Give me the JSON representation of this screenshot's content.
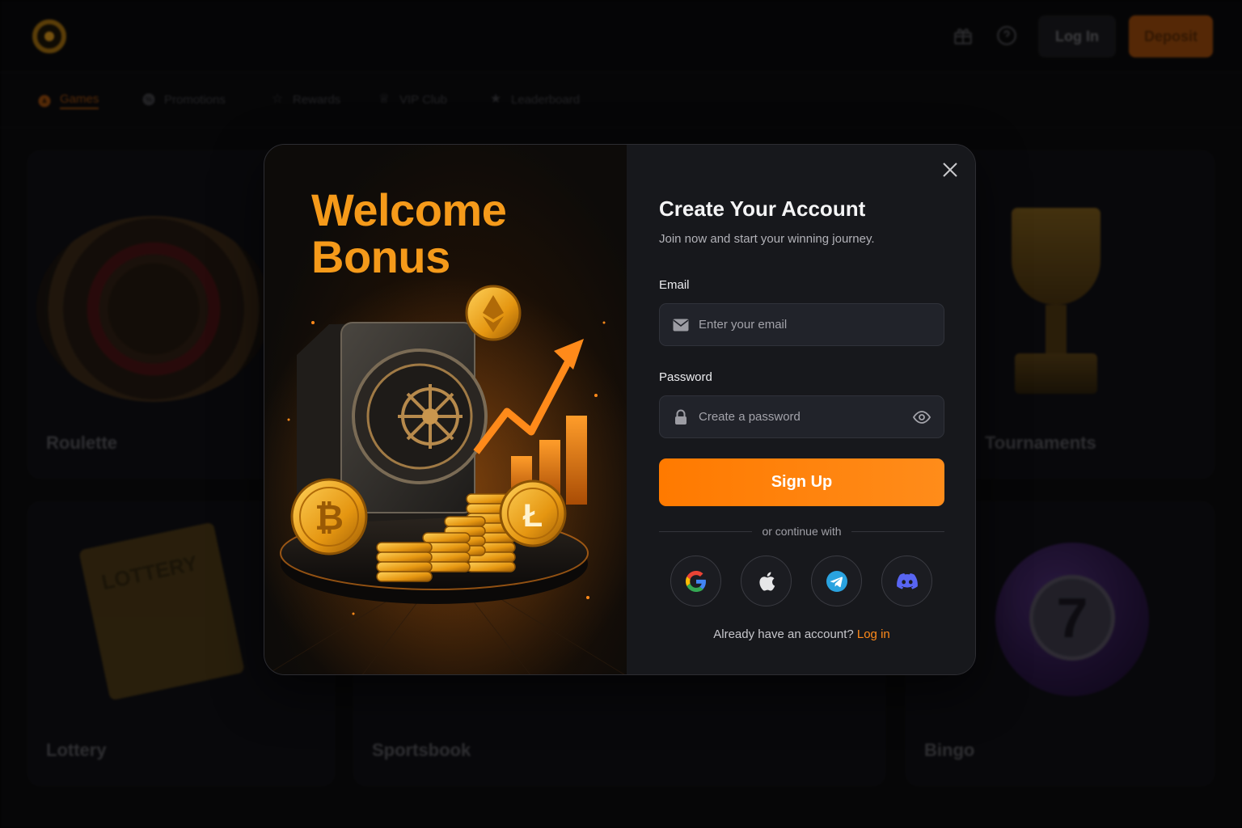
{
  "background": {
    "header": {
      "login_label": "Log In",
      "deposit_label": "Deposit"
    },
    "nav": [
      {
        "label": "Games",
        "icon": "flame-icon",
        "active": true
      },
      {
        "label": "Promotions",
        "icon": "percent-icon",
        "active": false
      },
      {
        "label": "Rewards",
        "icon": "star-icon",
        "active": false
      },
      {
        "label": "VIP Club",
        "icon": "crown-icon",
        "active": false
      },
      {
        "label": "Leaderboard",
        "icon": "star-icon",
        "active": false
      }
    ],
    "cards": [
      {
        "label": "Roulette"
      },
      {
        "label": "Tournaments"
      },
      {
        "label": "Lottery"
      },
      {
        "label": "Sportsbook"
      },
      {
        "label": "Bingo"
      }
    ],
    "ticket_text": "LOTTERY",
    "bingo_number": "7"
  },
  "modal": {
    "promo": {
      "line1": "Welcome",
      "line2": "Bonus"
    },
    "title": "Create Your Account",
    "subtitle": "Join now and start your winning journey.",
    "email": {
      "label": "Email",
      "placeholder": "Enter your email",
      "value": ""
    },
    "password": {
      "label": "Password",
      "placeholder": "Create a password",
      "value": ""
    },
    "signup_label": "Sign Up",
    "divider_text": "or continue with",
    "social": [
      "google-icon",
      "apple-icon",
      "telegram-icon",
      "discord-icon"
    ],
    "already_text": "Already have an account?",
    "login_link": "Log in"
  },
  "colors": {
    "accent": "#ff7a00",
    "promo_title": "#f59a1a",
    "modal_bg": "#17181c",
    "field_bg": "#21232a"
  }
}
